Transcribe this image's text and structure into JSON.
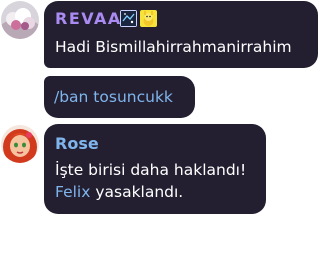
{
  "messages": [
    {
      "sender": "REVAA",
      "badges": [
        "sparkle-badge-icon",
        "yellow-pet-badge-icon"
      ],
      "text": "Hadi Bismillahirrahmanirrahim"
    },
    {
      "text": "/ban tosuncukk"
    },
    {
      "sender": "Rose",
      "line1": "İşte birisi daha haklandı!",
      "mention": "Felix",
      "line2_rest": " yasaklandı."
    }
  ],
  "colors": {
    "bubble": "#231f31",
    "revaa_name": "#a98bf2",
    "link": "#7fb5ec"
  }
}
